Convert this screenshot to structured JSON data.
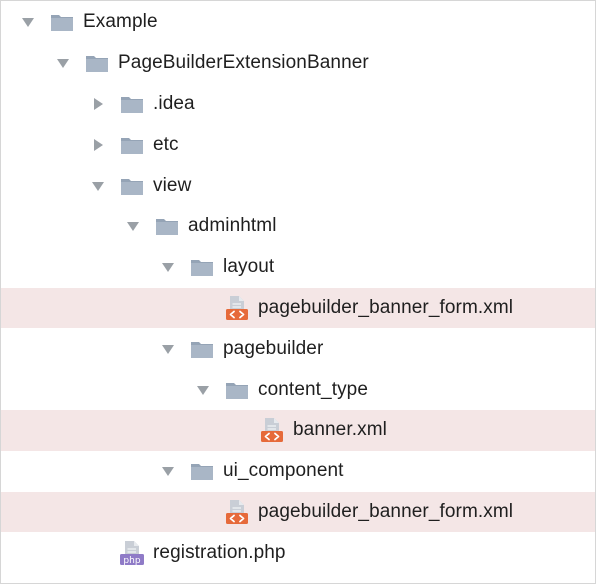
{
  "tree": {
    "nodes": [
      {
        "label": "Example",
        "depth": 0,
        "kind": "folder",
        "expand": "expanded"
      },
      {
        "label": "PageBuilderExtensionBanner",
        "depth": 1,
        "kind": "folder",
        "expand": "expanded"
      },
      {
        "label": ".idea",
        "depth": 2,
        "kind": "folder",
        "expand": "collapsed"
      },
      {
        "label": "etc",
        "depth": 2,
        "kind": "folder",
        "expand": "collapsed"
      },
      {
        "label": "view",
        "depth": 2,
        "kind": "folder",
        "expand": "expanded"
      },
      {
        "label": "adminhtml",
        "depth": 3,
        "kind": "folder",
        "expand": "expanded"
      },
      {
        "label": "layout",
        "depth": 4,
        "kind": "folder",
        "expand": "expanded"
      },
      {
        "label": "pagebuilder_banner_form.xml",
        "depth": 5,
        "kind": "xml",
        "expand": "none",
        "highlighted": true
      },
      {
        "label": "pagebuilder",
        "depth": 4,
        "kind": "folder",
        "expand": "expanded"
      },
      {
        "label": "content_type",
        "depth": 5,
        "kind": "folder",
        "expand": "expanded"
      },
      {
        "label": "banner.xml",
        "depth": 6,
        "kind": "xml",
        "expand": "none",
        "highlighted": true
      },
      {
        "label": "ui_component",
        "depth": 4,
        "kind": "folder",
        "expand": "expanded"
      },
      {
        "label": "pagebuilder_banner_form.xml",
        "depth": 5,
        "kind": "xml",
        "expand": "none",
        "highlighted": true
      },
      {
        "label": "registration.php",
        "depth": 2,
        "kind": "php",
        "expand": "none"
      }
    ]
  },
  "icons": {
    "folder": "folder-icon",
    "xml": "xml-file-icon",
    "php": "php-file-icon",
    "expanded": "triangle-down-icon",
    "collapsed": "triangle-right-icon",
    "php_badge": "php"
  },
  "colors": {
    "folder": "#a9b6c6",
    "folder_tab": "#95a4b6",
    "xml_badge": "#e66a3a",
    "php_badge": "#8f7bc7",
    "file_page": "#c9ced6",
    "arrow": "#9aa0a6",
    "highlight": "#f4e6e6"
  }
}
